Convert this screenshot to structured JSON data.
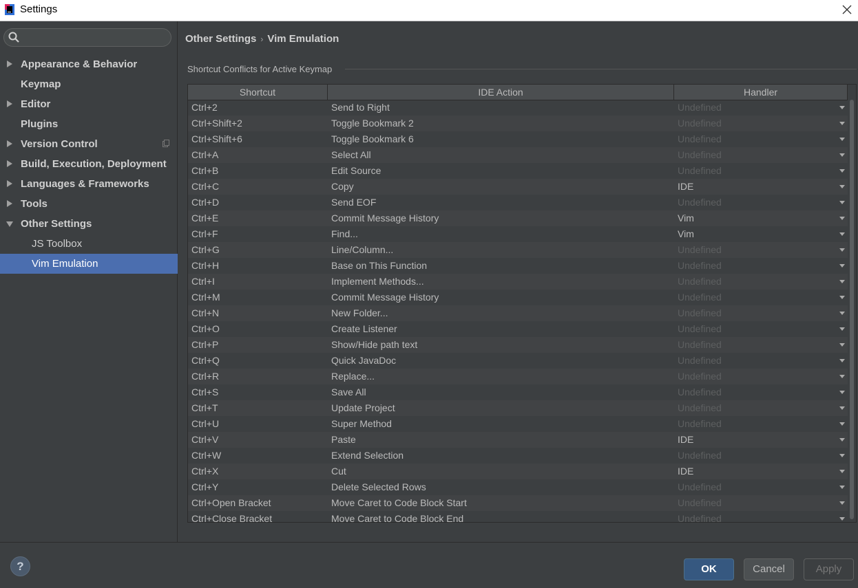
{
  "window": {
    "title": "Settings"
  },
  "search": {
    "placeholder": ""
  },
  "sidebar": {
    "items": [
      {
        "label": "Appearance & Behavior",
        "arrow": "right",
        "child": false
      },
      {
        "label": "Keymap",
        "arrow": "none",
        "child": false
      },
      {
        "label": "Editor",
        "arrow": "right",
        "child": false
      },
      {
        "label": "Plugins",
        "arrow": "none",
        "child": false
      },
      {
        "label": "Version Control",
        "arrow": "right",
        "child": false
      },
      {
        "label": "Build, Execution, Deployment",
        "arrow": "right",
        "child": false
      },
      {
        "label": "Languages & Frameworks",
        "arrow": "right",
        "child": false
      },
      {
        "label": "Tools",
        "arrow": "right",
        "child": false
      },
      {
        "label": "Other Settings",
        "arrow": "down",
        "child": false
      },
      {
        "label": "JS Toolbox",
        "arrow": "none",
        "child": true
      },
      {
        "label": "Vim Emulation",
        "arrow": "none",
        "child": true,
        "selected": true
      }
    ]
  },
  "breadcrumb": {
    "parent": "Other Settings",
    "separator": "›",
    "current": "Vim Emulation"
  },
  "section": {
    "title": "Shortcut Conflicts for Active Keymap"
  },
  "table": {
    "columns": [
      "Shortcut",
      "IDE Action",
      "Handler"
    ],
    "rows": [
      {
        "shortcut": "Ctrl+2",
        "action": "Send to Right",
        "handler": "Undefined"
      },
      {
        "shortcut": "Ctrl+Shift+2",
        "action": "Toggle Bookmark 2",
        "handler": "Undefined"
      },
      {
        "shortcut": "Ctrl+Shift+6",
        "action": "Toggle Bookmark 6",
        "handler": "Undefined"
      },
      {
        "shortcut": "Ctrl+A",
        "action": "Select All",
        "handler": "Undefined"
      },
      {
        "shortcut": "Ctrl+B",
        "action": "Edit Source",
        "handler": "Undefined"
      },
      {
        "shortcut": "Ctrl+C",
        "action": "Copy",
        "handler": "IDE"
      },
      {
        "shortcut": "Ctrl+D",
        "action": "Send EOF",
        "handler": "Undefined"
      },
      {
        "shortcut": "Ctrl+E",
        "action": "Commit Message History",
        "handler": "Vim"
      },
      {
        "shortcut": "Ctrl+F",
        "action": "Find...",
        "handler": "Vim"
      },
      {
        "shortcut": "Ctrl+G",
        "action": "Line/Column...",
        "handler": "Undefined"
      },
      {
        "shortcut": "Ctrl+H",
        "action": "Base on This Function",
        "handler": "Undefined"
      },
      {
        "shortcut": "Ctrl+I",
        "action": "Implement Methods...",
        "handler": "Undefined"
      },
      {
        "shortcut": "Ctrl+M",
        "action": "Commit Message History",
        "handler": "Undefined"
      },
      {
        "shortcut": "Ctrl+N",
        "action": "New Folder...",
        "handler": "Undefined"
      },
      {
        "shortcut": "Ctrl+O",
        "action": "Create Listener",
        "handler": "Undefined"
      },
      {
        "shortcut": "Ctrl+P",
        "action": "Show/Hide path text",
        "handler": "Undefined"
      },
      {
        "shortcut": "Ctrl+Q",
        "action": "Quick JavaDoc",
        "handler": "Undefined"
      },
      {
        "shortcut": "Ctrl+R",
        "action": "Replace...",
        "handler": "Undefined"
      },
      {
        "shortcut": "Ctrl+S",
        "action": "Save All",
        "handler": "Undefined"
      },
      {
        "shortcut": "Ctrl+T",
        "action": "Update Project",
        "handler": "Undefined"
      },
      {
        "shortcut": "Ctrl+U",
        "action": "Super Method",
        "handler": "Undefined"
      },
      {
        "shortcut": "Ctrl+V",
        "action": "Paste",
        "handler": "IDE"
      },
      {
        "shortcut": "Ctrl+W",
        "action": "Extend Selection",
        "handler": "Undefined"
      },
      {
        "shortcut": "Ctrl+X",
        "action": "Cut",
        "handler": "IDE"
      },
      {
        "shortcut": "Ctrl+Y",
        "action": "Delete Selected Rows",
        "handler": "Undefined"
      },
      {
        "shortcut": "Ctrl+Open Bracket",
        "action": "Move Caret to Code Block Start",
        "handler": "Undefined"
      },
      {
        "shortcut": "Ctrl+Close Bracket",
        "action": "Move Caret to Code Block End",
        "handler": "Undefined"
      }
    ]
  },
  "footer": {
    "help_label": "?",
    "ok_label": "OK",
    "cancel_label": "Cancel",
    "apply_label": "Apply"
  },
  "colors": {
    "selection": "#4b6eaf",
    "background": "#3c3f41",
    "ok_button": "#365880"
  }
}
